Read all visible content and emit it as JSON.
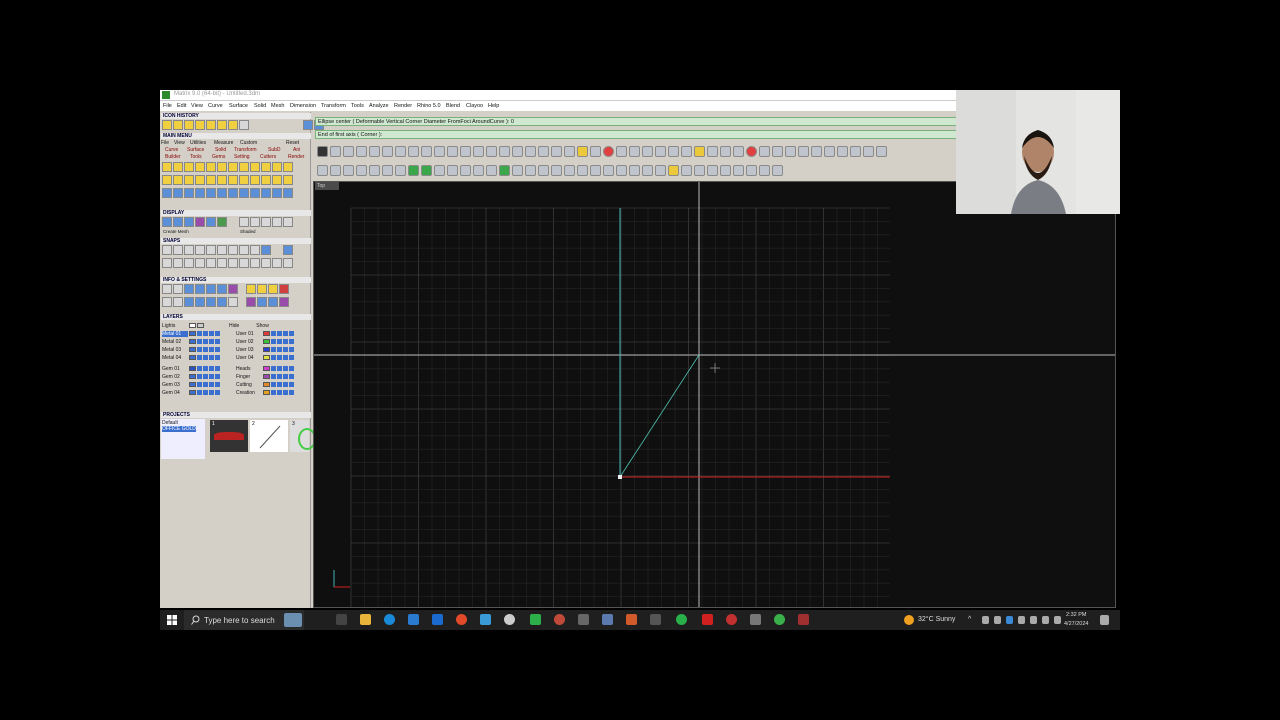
{
  "window": {
    "title": "Matrix 9.0 (64-bit) - Untitled.3dm"
  },
  "menu": [
    "File",
    "Edit",
    "View",
    "Curve",
    "Surface",
    "Solid",
    "Mesh",
    "Dimension",
    "Transform",
    "Tools",
    "Analyze",
    "Render",
    "Rhino 5.0",
    "Blend",
    "Clayoo",
    "Help"
  ],
  "left_panel": {
    "icon_history": "ICON HISTORY",
    "main_menu": "MAIN MENU",
    "main_menu_tabs": [
      "File",
      "View",
      "Utilities",
      "Measure",
      "Custom",
      "Reset"
    ],
    "main_menu_cats": [
      "Curve",
      "Surface",
      "Solid",
      "Transform",
      "SubD",
      "Ani",
      "Builder",
      "Tools",
      "Gems",
      "Setting",
      "Cutters",
      "Render"
    ],
    "display": "DISPLAY",
    "display_sub": [
      "Create Mesh",
      "Shaded"
    ],
    "snaps": "SNAPS",
    "info": "INFO & SETTINGS",
    "layers": "LAYERS",
    "lights": "Lights",
    "hide": "Hide",
    "show": "Show",
    "layers_left": [
      "Metal 01",
      "Metal 02",
      "Metal 03",
      "Metal 04",
      "Gem 01",
      "Gem 02",
      "Gem 03",
      "Gem 04"
    ],
    "layers_right": [
      "User 01",
      "User 02",
      "User 03",
      "User 04",
      "Heads",
      "Finger",
      "Cutting",
      "Creation"
    ],
    "layer_colors_left": [
      "#3a6fcf",
      "#3a6fcf",
      "#3a6fcf",
      "#3a6fcf",
      "#2a52c0",
      "#3a6fcf",
      "#3a6fcf",
      "#3a6fcf"
    ],
    "layer_colors_right": [
      "#e03a3a",
      "#3ac03a",
      "#2a40d0",
      "#e0e040",
      "#d040d0",
      "#9a4caa",
      "#e08a2a",
      "#e0a020"
    ],
    "projects": "PROJECTS",
    "project_items": [
      "Default",
      "OFFICE GOLD"
    ],
    "project_thumbs": [
      "1",
      "2",
      "3"
    ]
  },
  "command": {
    "line1": "Ellipse center ( Deformable  Vertical  Corner  Diameter  FromFoci  AroundCurve ): 0",
    "line2": "End of first axis ( Corner ):"
  },
  "viewport": {
    "label": "Top"
  },
  "taskbar": {
    "search_placeholder": "Type here to search",
    "weather": "32°C  Sunny",
    "time": "2:32 PM",
    "date": "4/27/2024"
  },
  "colors": {
    "command_bg": "#cfe8cf",
    "viewport_bg": "#0f0f0f",
    "x_axis": "#d02020",
    "y_axis": "#3fb3b3"
  }
}
